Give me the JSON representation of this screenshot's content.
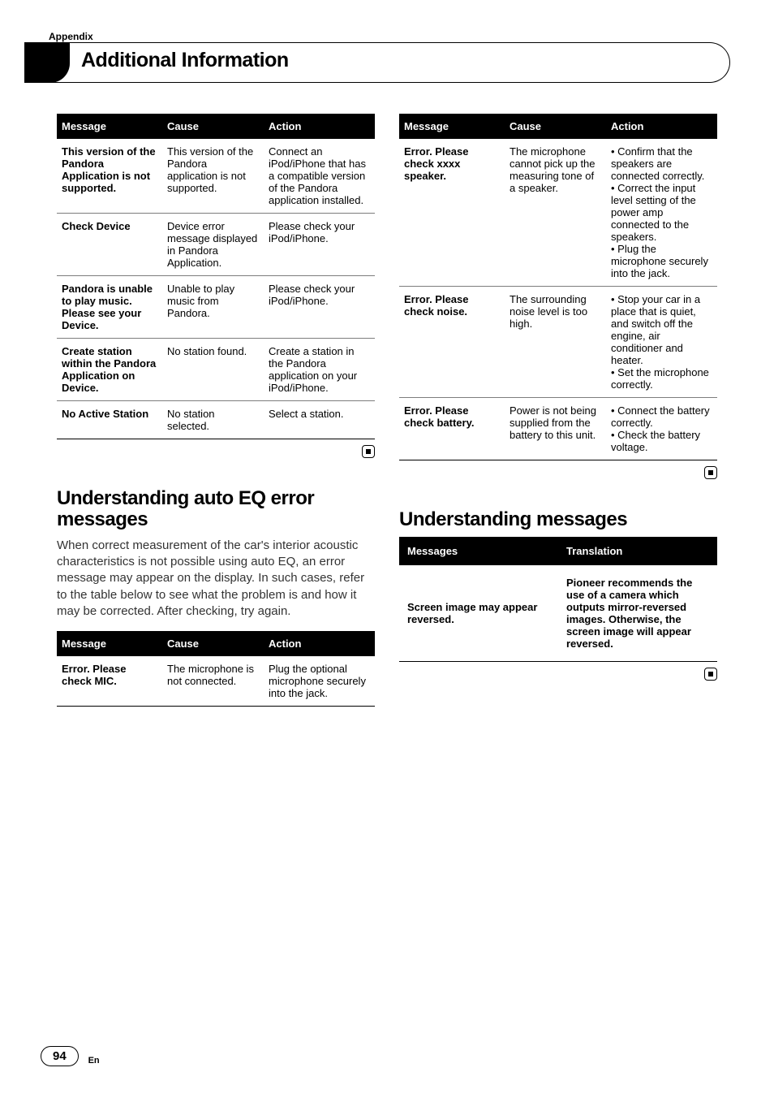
{
  "appendix": "Appendix",
  "main_title": "Additional Information",
  "table_headers": {
    "message": "Message",
    "cause": "Cause",
    "action": "Action"
  },
  "table_left": [
    {
      "message": "This version of the Pandora Application is not supported.",
      "cause": "This version of the Pandora application is not supported.",
      "action": "Connect an iPod/iPhone that has a compatible version of the Pandora application installed."
    },
    {
      "message": "Check Device",
      "cause": "Device error message displayed in Pandora Application.",
      "action": "Please check your iPod/iPhone."
    },
    {
      "message": "Pandora is unable to play music. Please see your Device.",
      "cause": "Unable to play music from Pandora.",
      "action": "Please check your iPod/iPhone."
    },
    {
      "message": "Create station within the Pandora Application on Device.",
      "cause": "No station found.",
      "action": "Create a station in the Pandora application on your iPod/iPhone."
    },
    {
      "message": "No Active Station",
      "cause": "No station selected.",
      "action": "Select a station."
    }
  ],
  "table_right": [
    {
      "message": "Error. Please check xxxx speaker.",
      "cause": "The microphone cannot pick up the measuring tone of a speaker.",
      "action_bullets": [
        "Confirm that the speakers are connected correctly.",
        "Correct the input level setting of the power amp connected to the speakers.",
        "Plug the microphone securely into the jack."
      ]
    },
    {
      "message": "Error. Please check noise.",
      "cause": "The surrounding noise level is too high.",
      "action_bullets": [
        "Stop your car in a place that is quiet, and switch off the engine, air conditioner and heater.",
        "Set the microphone correctly."
      ]
    },
    {
      "message": "Error. Please check battery.",
      "cause": "Power is not being supplied from the battery to this unit.",
      "action_bullets": [
        "Connect the battery correctly.",
        "Check the battery voltage."
      ]
    }
  ],
  "section_autoeq": {
    "title": "Understanding auto EQ error messages",
    "body": "When correct measurement of the car's interior acoustic characteristics is not possible using auto EQ, an error message may appear on the display. In such cases, refer to the table below to see what the problem is and how it may be corrected. After checking, try again.",
    "rows": [
      {
        "message": "Error. Please check MIC.",
        "cause": "The microphone is not connected.",
        "action": "Plug the optional microphone securely into the jack."
      }
    ]
  },
  "section_understanding": {
    "title": "Understanding messages",
    "headers": {
      "messages": "Messages",
      "translation": "Translation"
    },
    "rows": [
      {
        "message": "Screen image may appear reversed.",
        "translation": "Pioneer recommends the use of a camera which outputs mirror-reversed images. Otherwise, the screen image will appear reversed."
      }
    ]
  },
  "page": {
    "number": "94",
    "lang": "En"
  }
}
